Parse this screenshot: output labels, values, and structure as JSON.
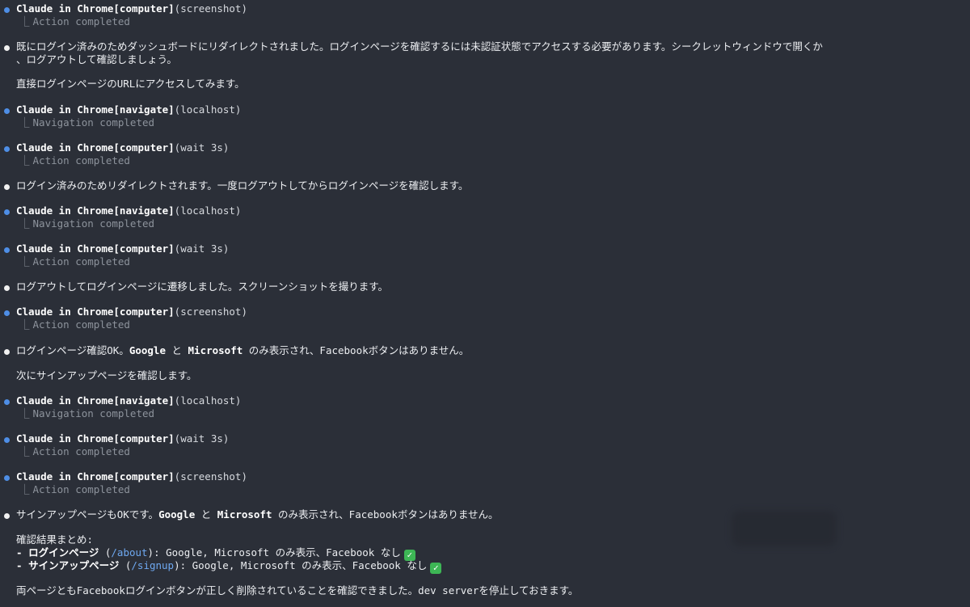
{
  "entries": [
    {
      "type": "tool",
      "name": "Claude in Chrome[computer]",
      "args": "(screenshot)",
      "result": "Action completed"
    },
    {
      "type": "msg",
      "lines": [
        "既にログイン済みのためダッシュボードにリダイレクトされました。ログインページを確認するには未認証状態でアクセスする必要があります。シークレットウィンドウで開くか",
        "、ログアウトして確認しましょう。",
        "",
        "直接ログインページのURLにアクセスしてみます。"
      ]
    },
    {
      "type": "tool",
      "name": "Claude in Chrome[navigate]",
      "args": "(localhost)",
      "result": "Navigation completed"
    },
    {
      "type": "tool",
      "name": "Claude in Chrome[computer]",
      "args": "(wait 3s)",
      "result": "Action completed"
    },
    {
      "type": "msg",
      "lines": [
        "ログイン済みのためリダイレクトされます。一度ログアウトしてからログインページを確認します。"
      ]
    },
    {
      "type": "tool",
      "name": "Claude in Chrome[navigate]",
      "args": "(localhost)",
      "result": "Navigation completed"
    },
    {
      "type": "tool",
      "name": "Claude in Chrome[computer]",
      "args": "(wait 3s)",
      "result": "Action completed"
    },
    {
      "type": "msg",
      "lines": [
        "ログアウトしてログインページに遷移しました。スクリーンショットを撮ります。"
      ]
    },
    {
      "type": "tool",
      "name": "Claude in Chrome[computer]",
      "args": "(screenshot)",
      "result": "Action completed"
    },
    {
      "type": "msg2",
      "a": "ログインページ確認OK。",
      "b1": "Google",
      "c": " と ",
      "b2": "Microsoft",
      "d": " のみ表示され、Facebookボタンはありません。",
      "next": "次にサインアップページを確認します。"
    },
    {
      "type": "tool",
      "name": "Claude in Chrome[navigate]",
      "args": "(localhost)",
      "result": "Navigation completed"
    },
    {
      "type": "tool",
      "name": "Claude in Chrome[computer]",
      "args": "(wait 3s)",
      "result": "Action completed"
    },
    {
      "type": "tool",
      "name": "Claude in Chrome[computer]",
      "args": "(screenshot)",
      "result": "Action completed"
    }
  ],
  "final": {
    "intro_a": "サインアップページもOKです。",
    "intro_b1": "Google",
    "intro_c": " と ",
    "intro_b2": "Microsoft",
    "intro_d": " のみ表示され、Facebookボタンはありません。",
    "summary_title": "確認結果まとめ:",
    "item1_dash": "- ",
    "item1_label": "ログインページ",
    "item1_path": "/about",
    "item1_rest": ": Google, Microsoft のみ表示、Facebook なし",
    "item2_dash": "- ",
    "item2_label": "サインアップページ",
    "item2_path": "/signup",
    "item2_rest": ": Google, Microsoft のみ表示、Facebook なし",
    "closing": "両ページともFacebookログインボタンが正しく削除されていることを確認できました。dev serverを停止しておきます。"
  },
  "symbols": {
    "corner": "⎿",
    "check": "✓"
  },
  "colors": {
    "background": "#2b2f38",
    "tool_bullet": "#4e8ee6",
    "msg_bullet": "#f1f1f1",
    "muted": "#8d939c",
    "path": "#6ea8f0",
    "check": "#3db655"
  }
}
